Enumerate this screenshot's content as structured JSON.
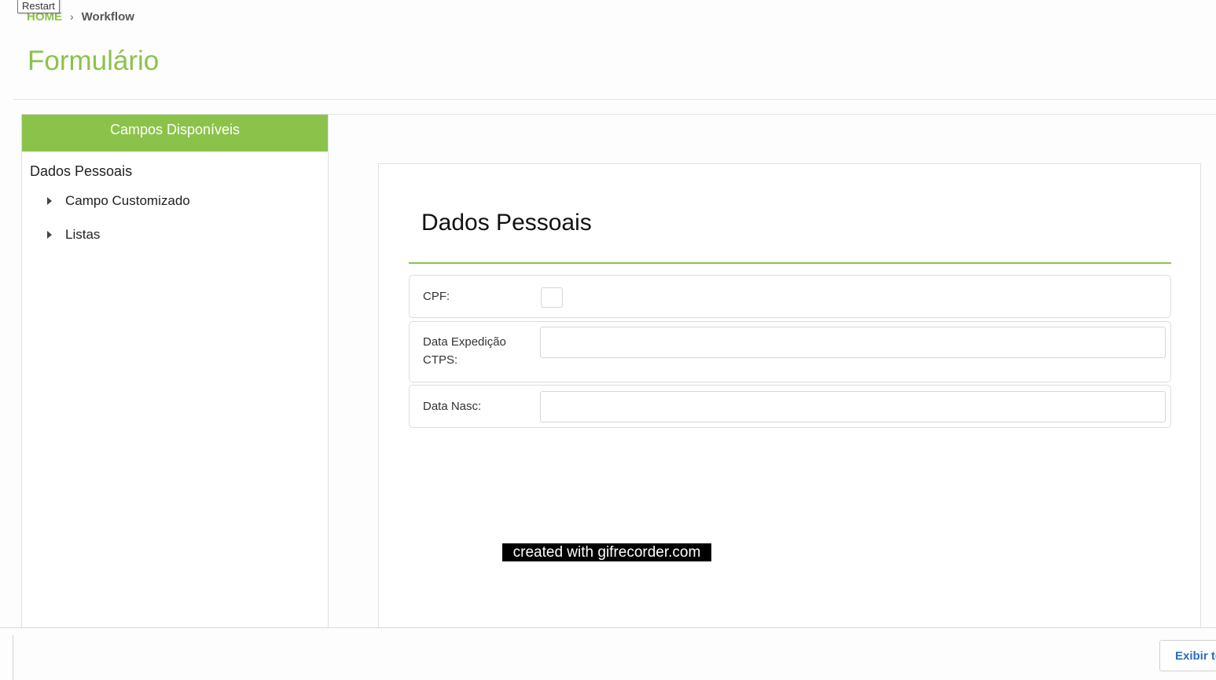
{
  "breadcrumb": {
    "home": "HOME",
    "separator": "›",
    "current": "Workflow"
  },
  "tooltip": {
    "text": "Restart"
  },
  "page": {
    "title": "Formulário"
  },
  "sidebar": {
    "header": "Campos Disponíveis",
    "section": "Dados Pessoais",
    "items": [
      {
        "label": "Campo Customizado"
      },
      {
        "label": "Listas"
      }
    ]
  },
  "form": {
    "section_title": "Dados Pessoais",
    "fields": [
      {
        "label": "CPF:",
        "value": ""
      },
      {
        "label": "Data Expedição CTPS:",
        "value": ""
      },
      {
        "label": "Data Nasc:",
        "value": ""
      }
    ]
  },
  "watermark": {
    "text": "created with gifrecorder.com"
  },
  "footer": {
    "show_all_label": "Exibir todos"
  },
  "colors": {
    "accent": "#8bc34a",
    "link": "#2a6fc2"
  }
}
